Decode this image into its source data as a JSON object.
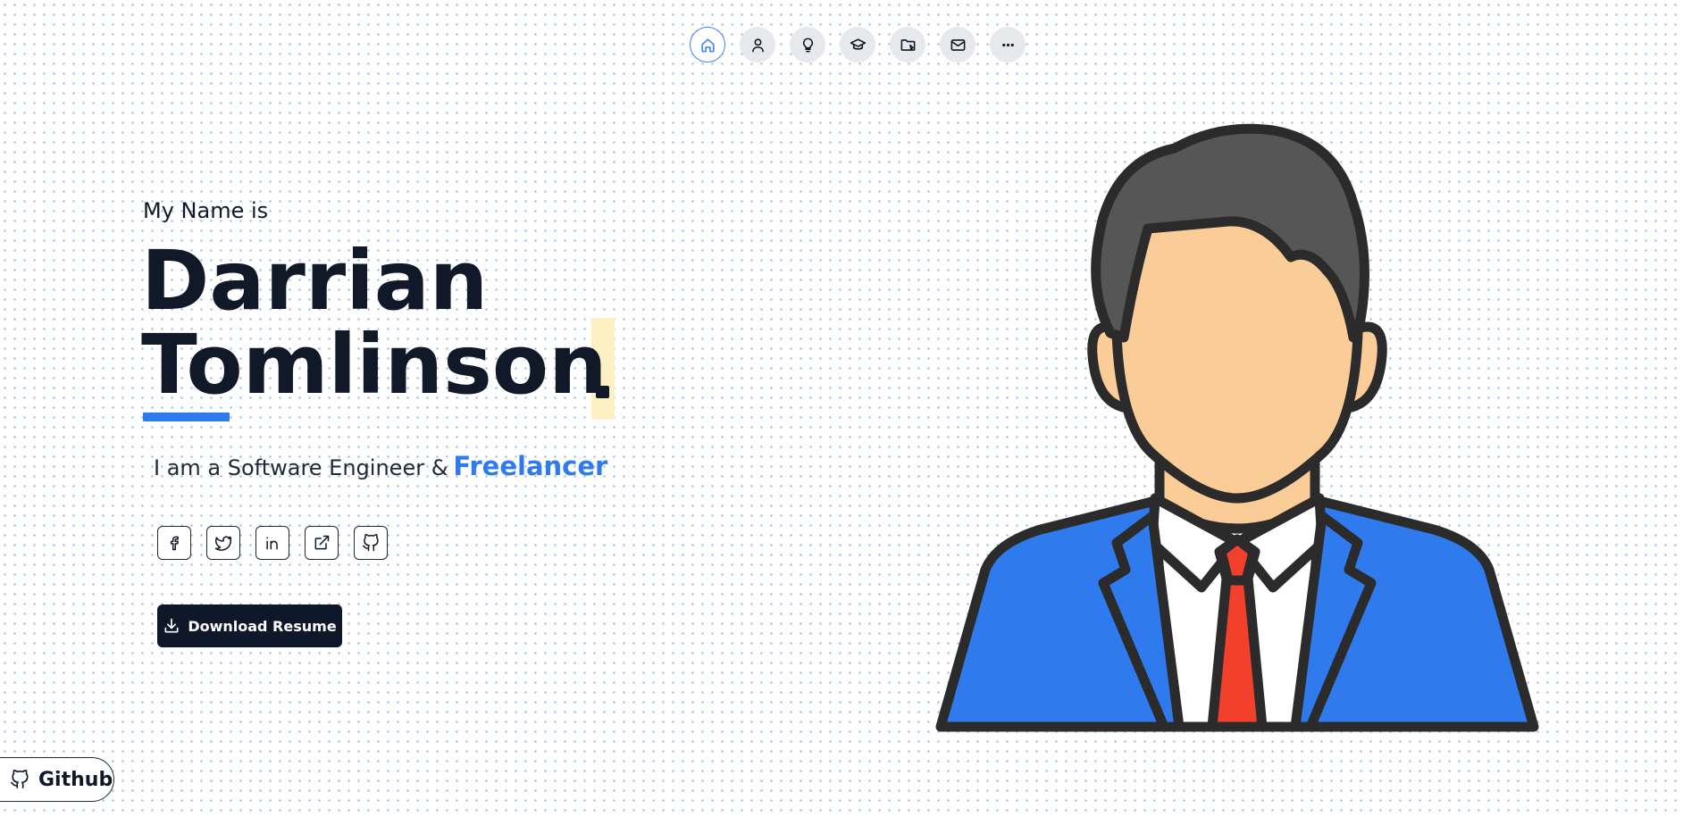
{
  "nav": {
    "items": [
      {
        "icon": "home-icon",
        "active": true
      },
      {
        "icon": "user-icon",
        "active": false
      },
      {
        "icon": "lightbulb-icon",
        "active": false
      },
      {
        "icon": "graduation-cap-icon",
        "active": false
      },
      {
        "icon": "folder-icon",
        "active": false
      },
      {
        "icon": "mail-icon",
        "active": false
      },
      {
        "icon": "more-icon",
        "active": false
      }
    ]
  },
  "hero": {
    "intro": "My Name is",
    "first_name": "Darrian",
    "last_name": "Tomlinson",
    "tagline": "I am a Software Engineer &",
    "highlight": "Freelancer",
    "download_label": "Download Resume"
  },
  "socials": [
    "facebook-icon",
    "twitter-icon",
    "linkedin-icon",
    "external-link-icon",
    "github-icon"
  ],
  "github_pill": {
    "label": "Github"
  },
  "colors": {
    "accent": "#2f7bed",
    "dark": "#0f172a",
    "dot_highlight": "#fdf0c2",
    "skin": "#f9cc98",
    "hair": "#575656",
    "suit": "#2f7bed",
    "tie": "#f2402c"
  }
}
